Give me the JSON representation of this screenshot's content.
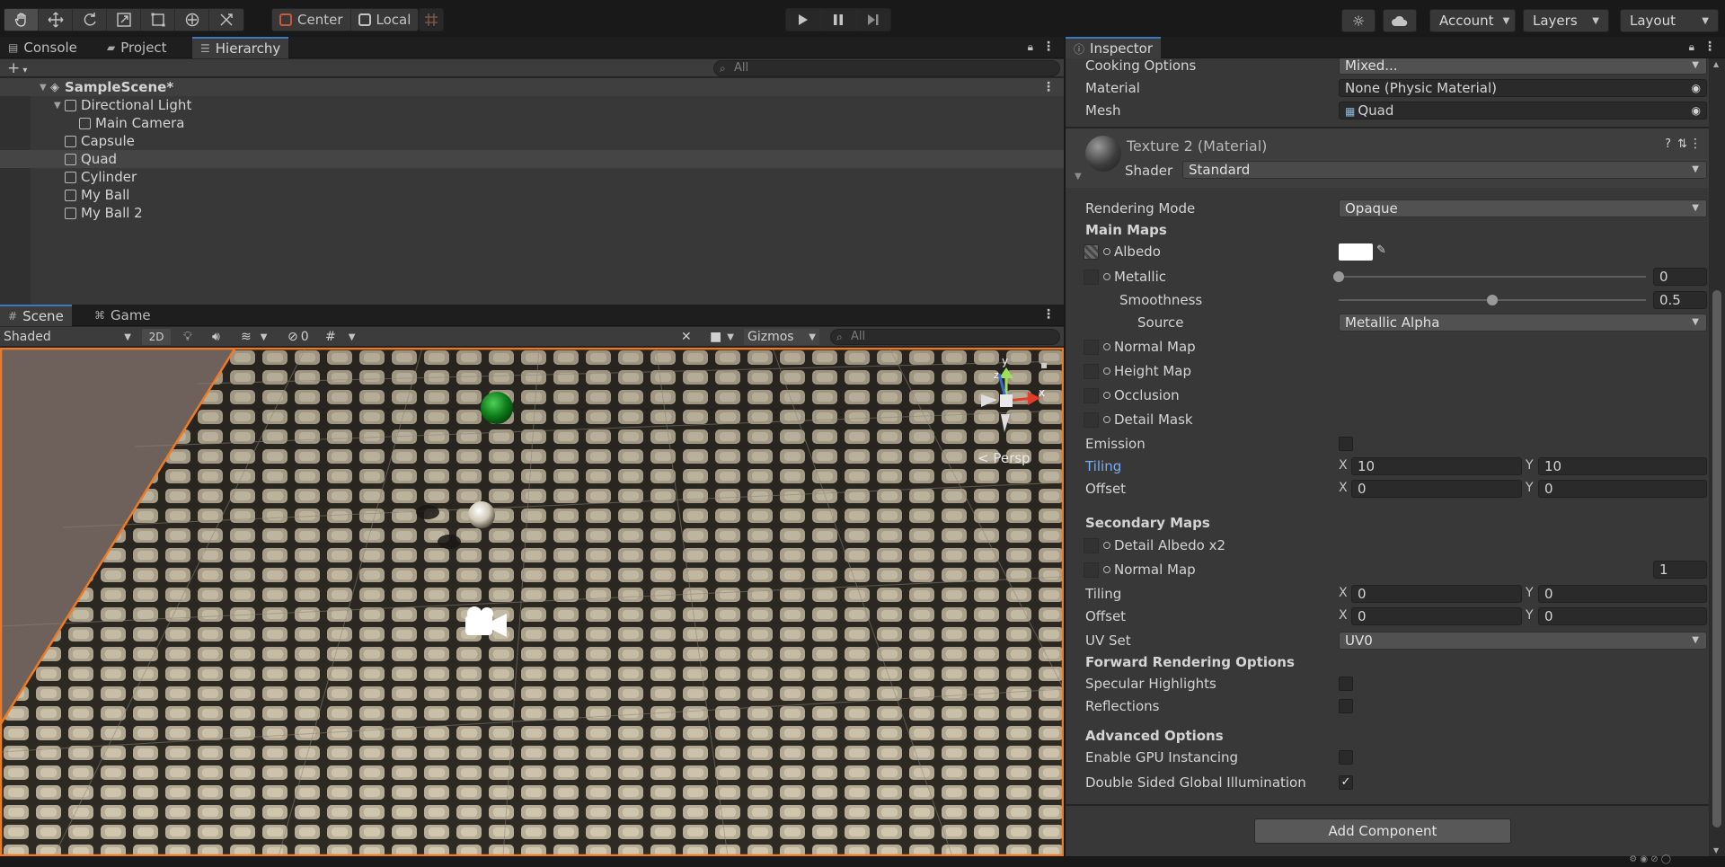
{
  "toolbar": {
    "tools": [
      "hand-tool",
      "move-tool",
      "rotate-tool",
      "scale-tool",
      "rect-tool",
      "transform-tool",
      "custom-tool"
    ],
    "pivot_mode": "Center",
    "pivot_rotation": "Local",
    "account": "Account",
    "layers": "Layers",
    "layout": "Layout"
  },
  "hierarchy": {
    "tabs": [
      "Console",
      "Project",
      "Hierarchy"
    ],
    "search_placeholder": "All",
    "scene_name": "SampleScene*",
    "items": [
      {
        "label": "Directional Light",
        "indent": 1,
        "fold": true
      },
      {
        "label": "Main Camera",
        "indent": 2,
        "fold": false
      },
      {
        "label": "Capsule",
        "indent": 1,
        "fold": false
      },
      {
        "label": "Quad",
        "indent": 1,
        "fold": false,
        "selected": true
      },
      {
        "label": "Cylinder",
        "indent": 1,
        "fold": false
      },
      {
        "label": "My Ball",
        "indent": 1,
        "fold": false
      },
      {
        "label": "My Ball 2",
        "indent": 1,
        "fold": false
      }
    ]
  },
  "scene": {
    "tabs": [
      "Scene",
      "Game"
    ],
    "shading_mode": "Shaded",
    "mode_2d": "2D",
    "hidden_count": "0",
    "gizmos": "Gizmos",
    "search_placeholder": "All",
    "persp_label": "< Persp",
    "axis_labels": {
      "y": "y",
      "x": "x",
      "z": "z"
    }
  },
  "inspector": {
    "tab": "Inspector",
    "cooking_options": {
      "label": "Cooking Options",
      "value": "Mixed..."
    },
    "material": {
      "label": "Material",
      "value": "None (Physic Material)"
    },
    "mesh": {
      "label": "Mesh",
      "value": "Quad"
    },
    "material_header": {
      "title": "Texture 2 (Material)",
      "shader_label": "Shader",
      "shader_value": "Standard"
    },
    "rendering_mode": {
      "label": "Rendering Mode",
      "value": "Opaque"
    },
    "main_maps_title": "Main Maps",
    "albedo": "Albedo",
    "albedo_color": "#ffffff",
    "metallic": {
      "label": "Metallic",
      "value": "0",
      "fraction": 0
    },
    "smoothness": {
      "label": "Smoothness",
      "value": "0.5",
      "fraction": 0.5
    },
    "source": {
      "label": "Source",
      "value": "Metallic Alpha"
    },
    "normal_map": "Normal Map",
    "height_map": "Height Map",
    "occlusion": "Occlusion",
    "detail_mask": "Detail Mask",
    "emission": "Emission",
    "tiling": {
      "label": "Tiling",
      "x": "10",
      "y": "10"
    },
    "offset": {
      "label": "Offset",
      "x": "0",
      "y": "0"
    },
    "secondary_maps_title": "Secondary Maps",
    "detail_albedo": "Detail Albedo x2",
    "secondary_normal_map": {
      "label": "Normal Map",
      "value": "1"
    },
    "sec_tiling": {
      "label": "Tiling",
      "x": "0",
      "y": "0"
    },
    "sec_offset": {
      "label": "Offset",
      "x": "0",
      "y": "0"
    },
    "uv_set": {
      "label": "UV Set",
      "value": "UV0"
    },
    "forward_title": "Forward Rendering Options",
    "specular_highlights": "Specular Highlights",
    "reflections": "Reflections",
    "advanced_title": "Advanced Options",
    "gpu_instancing": "Enable GPU Instancing",
    "double_sided_gi": {
      "label": "Double Sided Global Illumination",
      "checked": "✓"
    },
    "add_component": "Add Component",
    "x_label": "X",
    "y_label": "Y"
  }
}
